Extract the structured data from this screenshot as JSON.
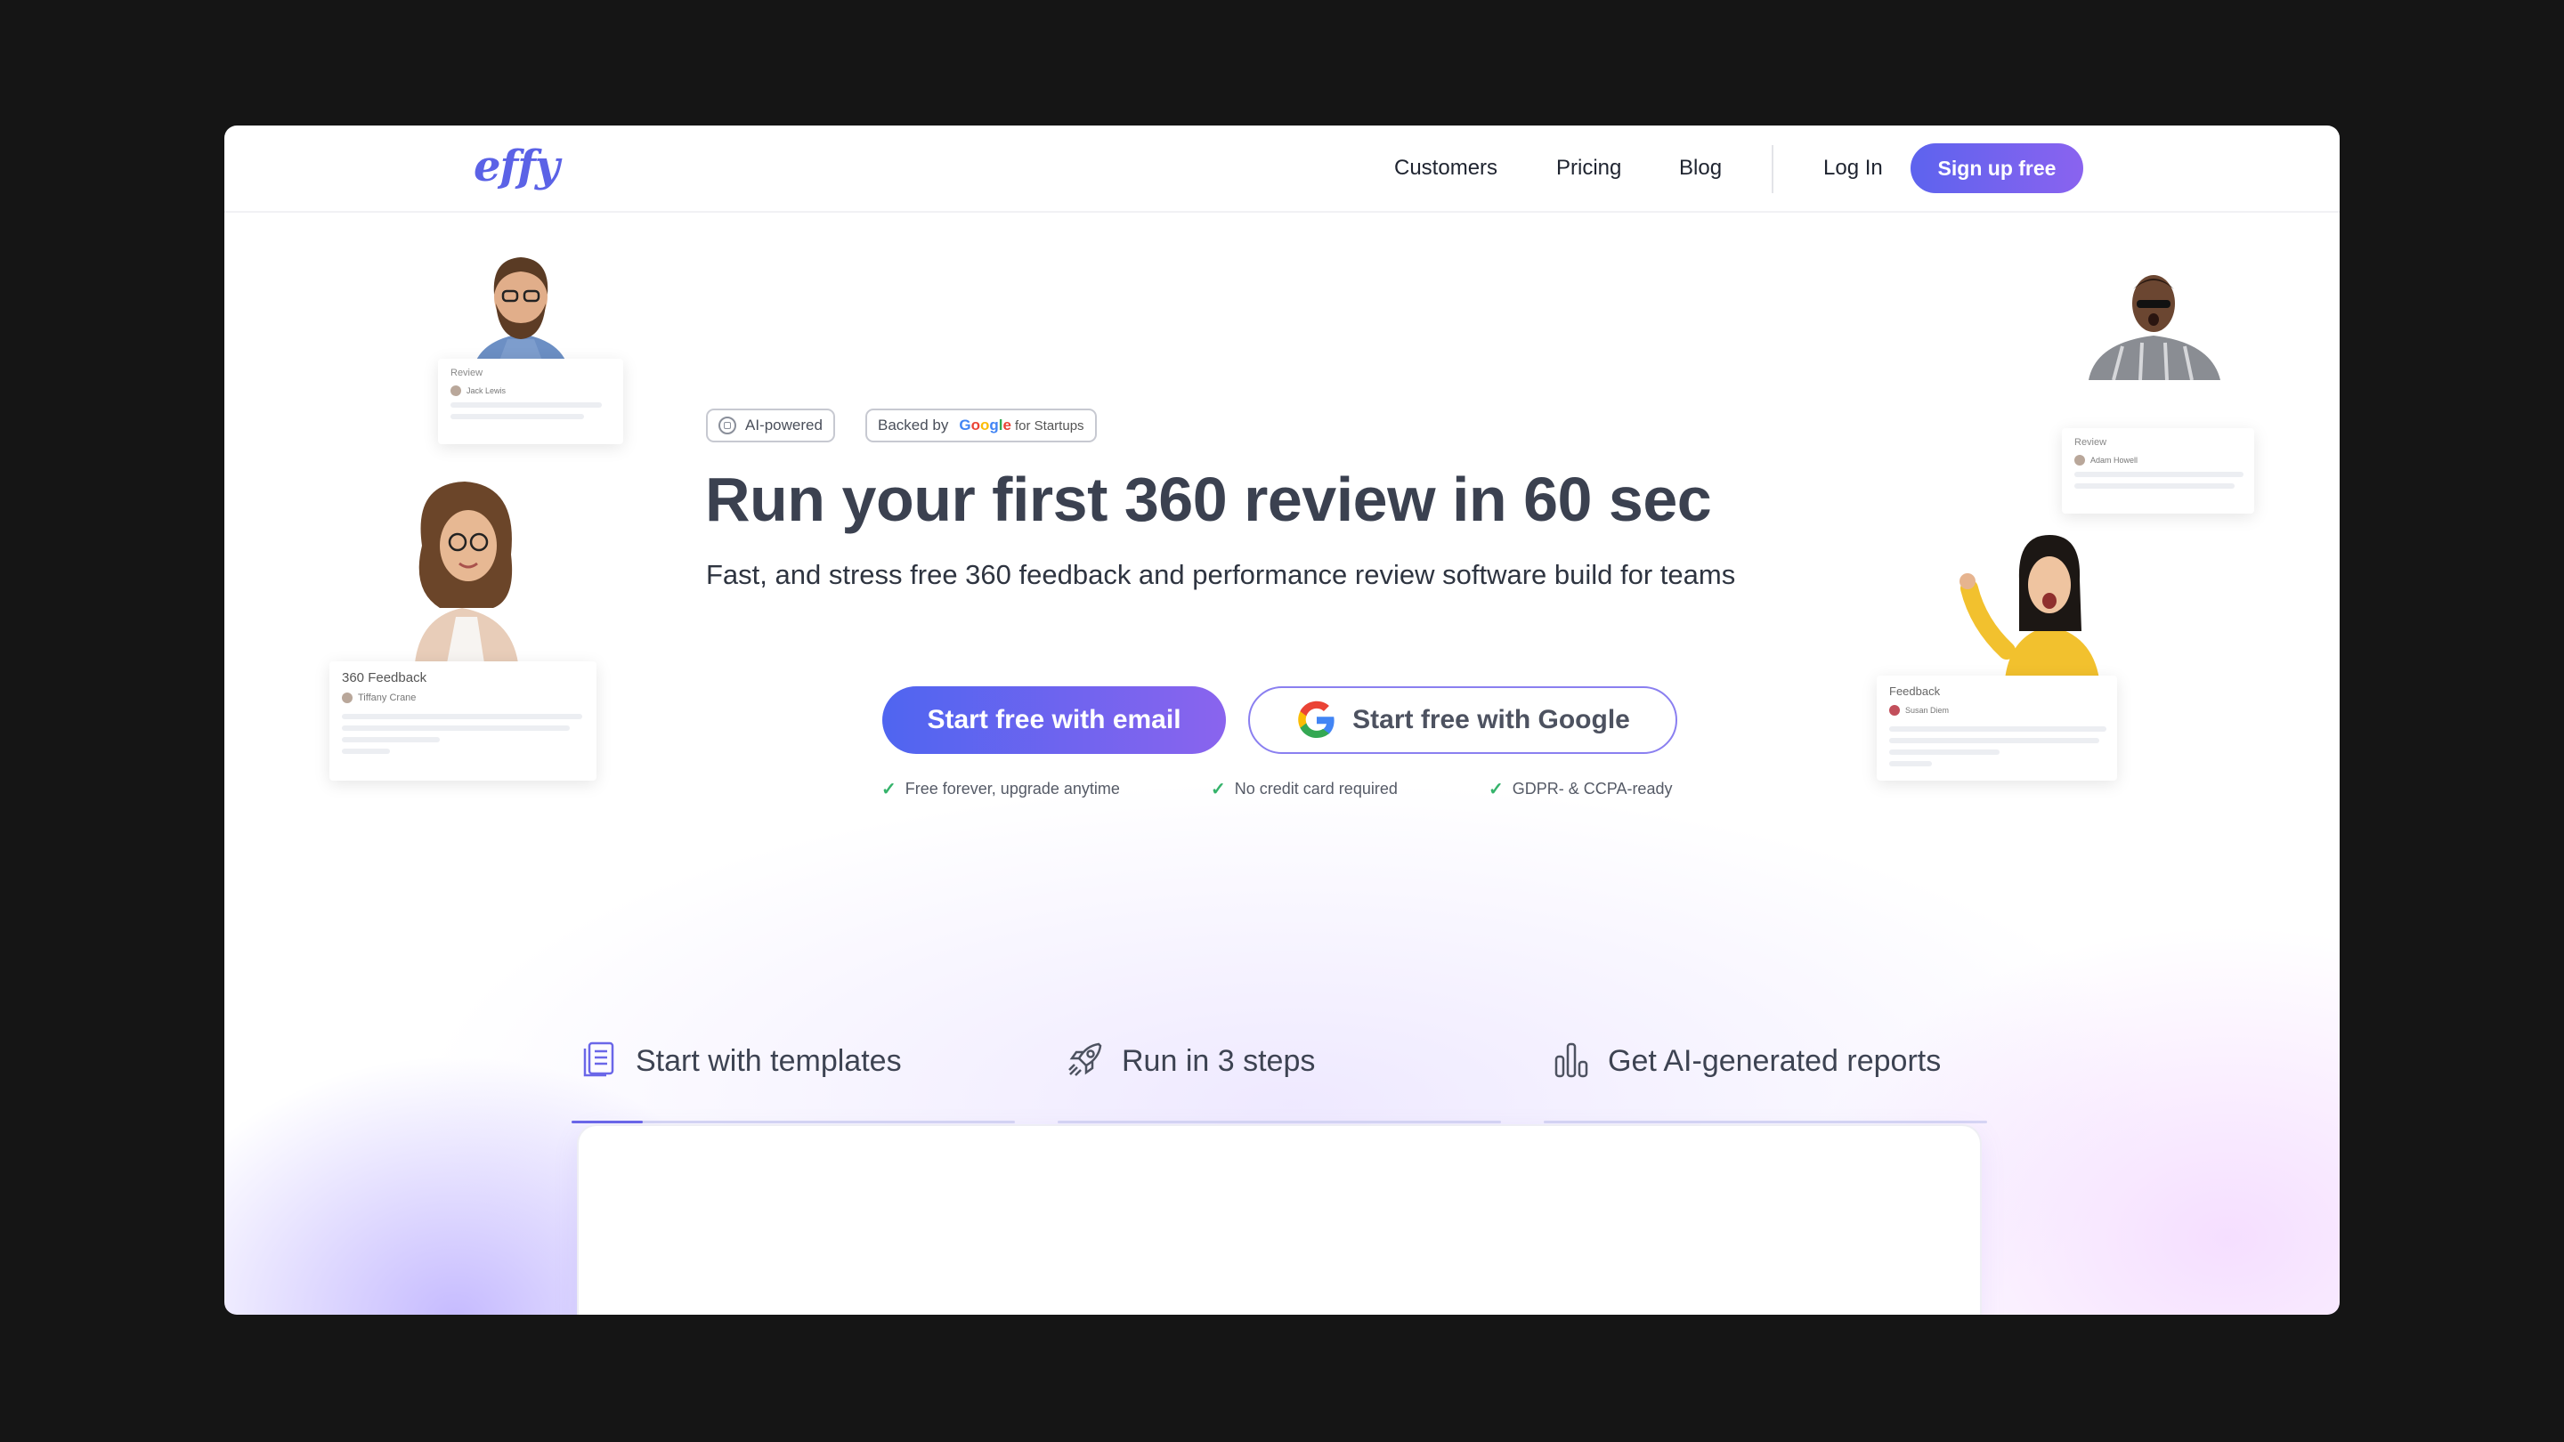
{
  "nav": {
    "logo": "effy",
    "links": [
      "Customers",
      "Pricing",
      "Blog"
    ],
    "login": "Log In",
    "signup": "Sign up free"
  },
  "badges": {
    "ai": "AI-powered",
    "backed_by": "Backed by",
    "google_letters": [
      "G",
      "o",
      "o",
      "g",
      "l",
      "e"
    ],
    "for_startups": "for Startups"
  },
  "hero": {
    "headline": "Run your first 360 review in 60 sec",
    "subline": "Fast, and stress free 360 feedback and performance review software build for teams",
    "cta_email": "Start free with email",
    "cta_google": "Start free with Google",
    "perks": [
      "Free forever, upgrade anytime",
      "No credit card required",
      "GDPR- & CCPA-ready"
    ]
  },
  "cards": {
    "top_left": {
      "title": "Review",
      "name": "Jack Lewis"
    },
    "left": {
      "title": "360 Feedback",
      "name": "Tiffany Crane"
    },
    "top_right": {
      "title": "Review",
      "name": "Adam Howell"
    },
    "right": {
      "title": "Feedback",
      "name": "Susan Diem"
    }
  },
  "tabs": [
    {
      "label": "Start with templates",
      "icon": "document-list-icon"
    },
    {
      "label": "Run in 3 steps",
      "icon": "rocket-icon"
    },
    {
      "label": "Get AI-generated reports",
      "icon": "bar-chart-icon"
    }
  ],
  "colors": {
    "accent": "#5b62e6",
    "gradient_end": "#8a63ef",
    "check": "#35b36b"
  }
}
